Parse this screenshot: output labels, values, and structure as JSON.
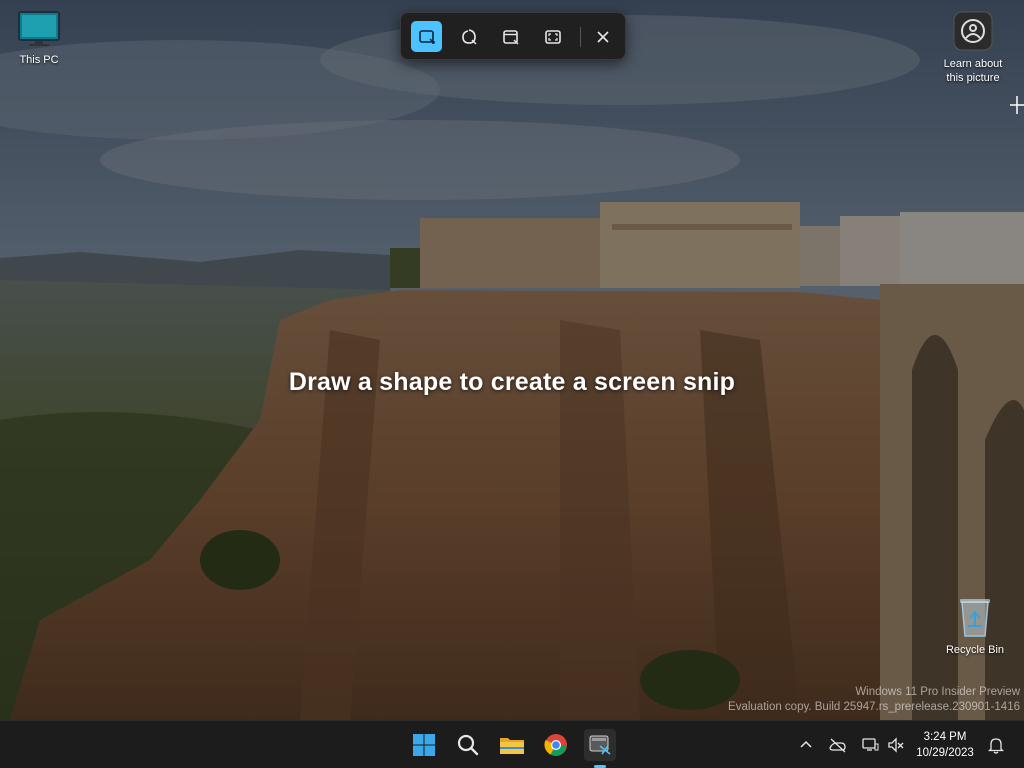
{
  "desktop": {
    "icons": {
      "this_pc": "This PC",
      "learn_line1": "Learn about",
      "learn_line2": "this picture",
      "recycle_bin": "Recycle Bin"
    },
    "watermark": {
      "line1": "Windows 11 Pro Insider Preview",
      "line2": "Evaluation copy. Build 25947.rs_prerelease.230901-1416"
    }
  },
  "snip_toolbar": {
    "modes": [
      {
        "name": "rectangle",
        "icon": "rectangle-snip-icon",
        "active": true
      },
      {
        "name": "freeform",
        "icon": "freeform-snip-icon",
        "active": false
      },
      {
        "name": "window",
        "icon": "window-snip-icon",
        "active": false
      },
      {
        "name": "fullscreen",
        "icon": "fullscreen-snip-icon",
        "active": false
      }
    ],
    "close_icon": "close-icon",
    "accent_color": "#4cc2ff"
  },
  "overlay": {
    "instruction": "Draw a shape to create a screen snip"
  },
  "taskbar": {
    "apps": [
      "start-icon",
      "search-icon",
      "file-explorer-icon",
      "chrome-icon",
      "snipping-tool-icon"
    ],
    "tray": [
      "chevron-up-icon",
      "network-off-icon",
      "device-icon",
      "volume-muted-icon",
      "notification-bell-icon"
    ],
    "clock": {
      "time": "3:24 PM",
      "date": "10/29/2023"
    }
  }
}
